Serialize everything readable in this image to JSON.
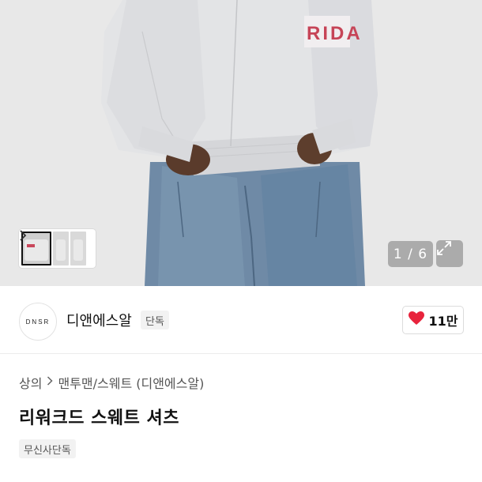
{
  "gallery": {
    "counter": "1 / 6",
    "thumbnail_count": 3
  },
  "brand": {
    "logo_text": "DNSR",
    "name": "디앤에스알",
    "badge": "단독",
    "likes": "11만",
    "heart_color": "#e8233c"
  },
  "breadcrumb": {
    "category": "상의",
    "subcategory": "맨투맨/스웨트 (디앤에스알)"
  },
  "product": {
    "title": "리워크드 스웨트 셔츠",
    "tag": "무신사단독"
  },
  "icons": {
    "thumb_next": "chevron-right-icon",
    "expand": "expand-icon",
    "like": "heart-icon"
  }
}
